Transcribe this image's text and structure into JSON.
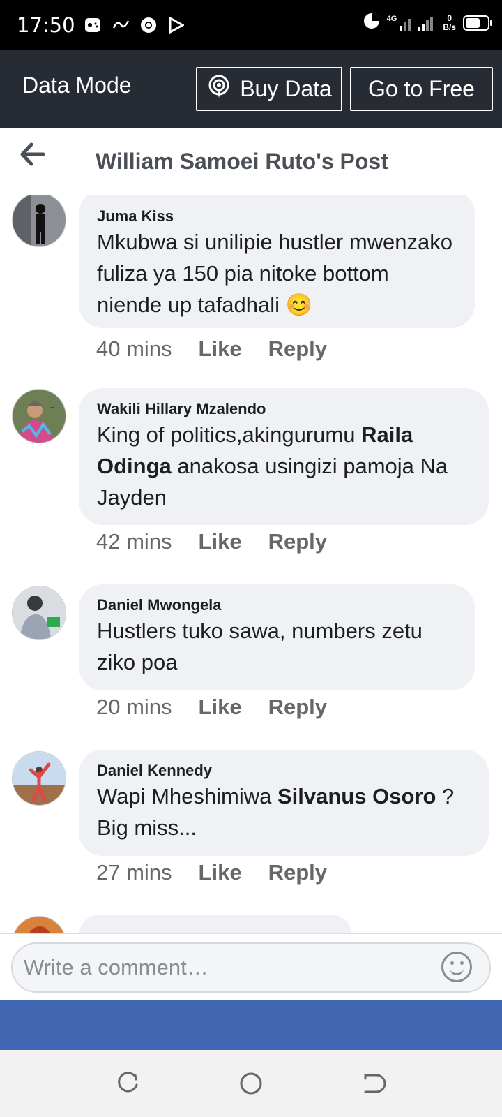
{
  "status": {
    "time": "17:50",
    "network": "4G",
    "speed_value": "0",
    "speed_unit": "B/s"
  },
  "databar": {
    "mode_label": "Data Mode",
    "buy_label": "Buy Data",
    "free_label": "Go to Free"
  },
  "header": {
    "title": "William Samoei Ruto's Post"
  },
  "comments": [
    {
      "name": "Juma Kiss",
      "text": "Mkubwa si unilipie hustler mwenzako fuliza ya 150 pia nitoke bottom niende up tafadhali",
      "emoji": "😊",
      "time": "40 mins",
      "like": "Like",
      "reply": "Reply"
    },
    {
      "name": "Wakili Hillary Mzalendo",
      "text_pre": "King of politics,akingurumu ",
      "mention": "Raila Odinga",
      "text_post": " anakosa usingizi pamoja Na Jayden",
      "time": "42 mins",
      "like": "Like",
      "reply": "Reply"
    },
    {
      "name": "Daniel Mwongela",
      "text": "Hustlers tuko sawa, numbers zetu ziko poa",
      "time": "20 mins",
      "like": "Like",
      "reply": "Reply"
    },
    {
      "name": "Daniel Kennedy",
      "text_pre": "Wapi Mheshimiwa ",
      "mention": "Silvanus Osoro",
      "text_post": " ? Big miss...",
      "time": "27 mins",
      "like": "Like",
      "reply": "Reply"
    }
  ],
  "composer": {
    "placeholder": "Write a comment…"
  },
  "colors": {
    "status_bar": "#000000",
    "data_bar": "#272c34",
    "brand_blue": "#4267b2",
    "bubble": "#f0f1f4"
  },
  "icons": {
    "back": "arrow-left-icon",
    "buy": "broadcast-icon",
    "emoji": "smiley-icon"
  }
}
